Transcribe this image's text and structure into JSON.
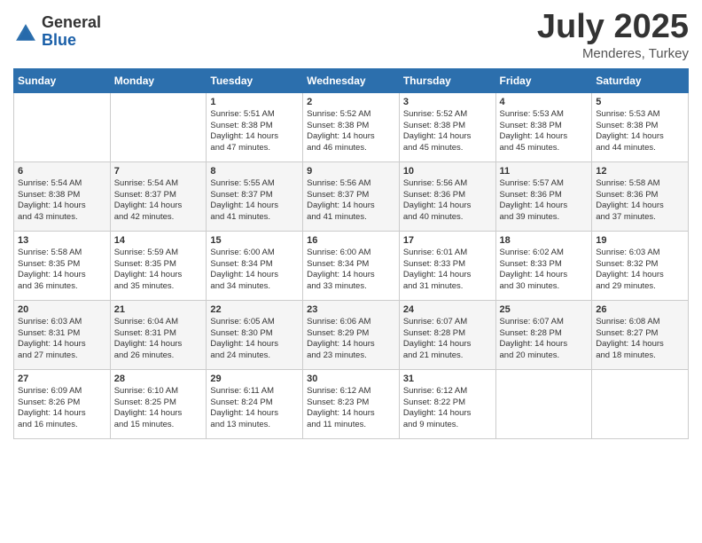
{
  "logo": {
    "general": "General",
    "blue": "Blue"
  },
  "title": "July 2025",
  "subtitle": "Menderes, Turkey",
  "days_of_week": [
    "Sunday",
    "Monday",
    "Tuesday",
    "Wednesday",
    "Thursday",
    "Friday",
    "Saturday"
  ],
  "weeks": [
    [
      {
        "day": "",
        "detail": ""
      },
      {
        "day": "",
        "detail": ""
      },
      {
        "day": "1",
        "detail": "Sunrise: 5:51 AM\nSunset: 8:38 PM\nDaylight: 14 hours\nand 47 minutes."
      },
      {
        "day": "2",
        "detail": "Sunrise: 5:52 AM\nSunset: 8:38 PM\nDaylight: 14 hours\nand 46 minutes."
      },
      {
        "day": "3",
        "detail": "Sunrise: 5:52 AM\nSunset: 8:38 PM\nDaylight: 14 hours\nand 45 minutes."
      },
      {
        "day": "4",
        "detail": "Sunrise: 5:53 AM\nSunset: 8:38 PM\nDaylight: 14 hours\nand 45 minutes."
      },
      {
        "day": "5",
        "detail": "Sunrise: 5:53 AM\nSunset: 8:38 PM\nDaylight: 14 hours\nand 44 minutes."
      }
    ],
    [
      {
        "day": "6",
        "detail": "Sunrise: 5:54 AM\nSunset: 8:38 PM\nDaylight: 14 hours\nand 43 minutes."
      },
      {
        "day": "7",
        "detail": "Sunrise: 5:54 AM\nSunset: 8:37 PM\nDaylight: 14 hours\nand 42 minutes."
      },
      {
        "day": "8",
        "detail": "Sunrise: 5:55 AM\nSunset: 8:37 PM\nDaylight: 14 hours\nand 41 minutes."
      },
      {
        "day": "9",
        "detail": "Sunrise: 5:56 AM\nSunset: 8:37 PM\nDaylight: 14 hours\nand 41 minutes."
      },
      {
        "day": "10",
        "detail": "Sunrise: 5:56 AM\nSunset: 8:36 PM\nDaylight: 14 hours\nand 40 minutes."
      },
      {
        "day": "11",
        "detail": "Sunrise: 5:57 AM\nSunset: 8:36 PM\nDaylight: 14 hours\nand 39 minutes."
      },
      {
        "day": "12",
        "detail": "Sunrise: 5:58 AM\nSunset: 8:36 PM\nDaylight: 14 hours\nand 37 minutes."
      }
    ],
    [
      {
        "day": "13",
        "detail": "Sunrise: 5:58 AM\nSunset: 8:35 PM\nDaylight: 14 hours\nand 36 minutes."
      },
      {
        "day": "14",
        "detail": "Sunrise: 5:59 AM\nSunset: 8:35 PM\nDaylight: 14 hours\nand 35 minutes."
      },
      {
        "day": "15",
        "detail": "Sunrise: 6:00 AM\nSunset: 8:34 PM\nDaylight: 14 hours\nand 34 minutes."
      },
      {
        "day": "16",
        "detail": "Sunrise: 6:00 AM\nSunset: 8:34 PM\nDaylight: 14 hours\nand 33 minutes."
      },
      {
        "day": "17",
        "detail": "Sunrise: 6:01 AM\nSunset: 8:33 PM\nDaylight: 14 hours\nand 31 minutes."
      },
      {
        "day": "18",
        "detail": "Sunrise: 6:02 AM\nSunset: 8:33 PM\nDaylight: 14 hours\nand 30 minutes."
      },
      {
        "day": "19",
        "detail": "Sunrise: 6:03 AM\nSunset: 8:32 PM\nDaylight: 14 hours\nand 29 minutes."
      }
    ],
    [
      {
        "day": "20",
        "detail": "Sunrise: 6:03 AM\nSunset: 8:31 PM\nDaylight: 14 hours\nand 27 minutes."
      },
      {
        "day": "21",
        "detail": "Sunrise: 6:04 AM\nSunset: 8:31 PM\nDaylight: 14 hours\nand 26 minutes."
      },
      {
        "day": "22",
        "detail": "Sunrise: 6:05 AM\nSunset: 8:30 PM\nDaylight: 14 hours\nand 24 minutes."
      },
      {
        "day": "23",
        "detail": "Sunrise: 6:06 AM\nSunset: 8:29 PM\nDaylight: 14 hours\nand 23 minutes."
      },
      {
        "day": "24",
        "detail": "Sunrise: 6:07 AM\nSunset: 8:28 PM\nDaylight: 14 hours\nand 21 minutes."
      },
      {
        "day": "25",
        "detail": "Sunrise: 6:07 AM\nSunset: 8:28 PM\nDaylight: 14 hours\nand 20 minutes."
      },
      {
        "day": "26",
        "detail": "Sunrise: 6:08 AM\nSunset: 8:27 PM\nDaylight: 14 hours\nand 18 minutes."
      }
    ],
    [
      {
        "day": "27",
        "detail": "Sunrise: 6:09 AM\nSunset: 8:26 PM\nDaylight: 14 hours\nand 16 minutes."
      },
      {
        "day": "28",
        "detail": "Sunrise: 6:10 AM\nSunset: 8:25 PM\nDaylight: 14 hours\nand 15 minutes."
      },
      {
        "day": "29",
        "detail": "Sunrise: 6:11 AM\nSunset: 8:24 PM\nDaylight: 14 hours\nand 13 minutes."
      },
      {
        "day": "30",
        "detail": "Sunrise: 6:12 AM\nSunset: 8:23 PM\nDaylight: 14 hours\nand 11 minutes."
      },
      {
        "day": "31",
        "detail": "Sunrise: 6:12 AM\nSunset: 8:22 PM\nDaylight: 14 hours\nand 9 minutes."
      },
      {
        "day": "",
        "detail": ""
      },
      {
        "day": "",
        "detail": ""
      }
    ]
  ]
}
